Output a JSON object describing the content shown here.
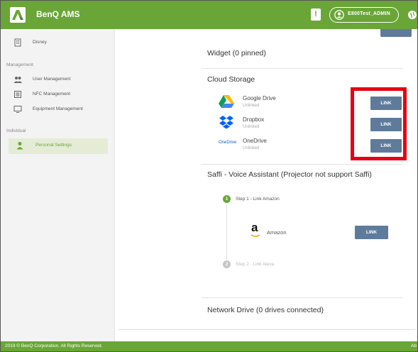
{
  "app": {
    "title": "BenQ AMS"
  },
  "header": {
    "user_name": "E800Test_ADMIN"
  },
  "sidebar": {
    "top_item": "Disney",
    "management_label": "Management",
    "items": [
      {
        "label": "User Management"
      },
      {
        "label": "NFC Management"
      },
      {
        "label": "Equipment Management"
      }
    ],
    "individual_label": "Individual",
    "personal_settings": "Personal Settings"
  },
  "main": {
    "widget_title": "Widget (0 pinned)",
    "cloud_title": "Cloud Storage",
    "cloud_services": [
      {
        "name": "Google Drive",
        "status": "Unlinked",
        "button": "LINK",
        "icon": "google-drive-icon"
      },
      {
        "name": "Dropbox",
        "status": "Unlinked",
        "button": "LINK",
        "icon": "dropbox-icon"
      },
      {
        "name": "OneDrive",
        "status": "Unlinked",
        "button": "LINK",
        "icon": "onedrive-icon",
        "logo_text": "OneDrive"
      }
    ],
    "saffi_title": "Saffi - Voice Assistant (Projector not support Saffi)",
    "steps": [
      {
        "number": "1",
        "label": "Step 1 - Link Amazon"
      },
      {
        "number": "2",
        "label": "Step 2 - Link Alexa"
      }
    ],
    "amazon": {
      "name": "Amazon",
      "button": "LINK",
      "logo_letter": "a"
    },
    "network_title": "Network Drive (0 drives connected)"
  },
  "footer": {
    "copyright": "2019 © BenQ Corporation. All Rights Reserved.",
    "right_text": "Ab"
  },
  "colors": {
    "brand_green": "#69a637",
    "link_button": "#5f7b9c",
    "highlight_red": "#e60012"
  }
}
